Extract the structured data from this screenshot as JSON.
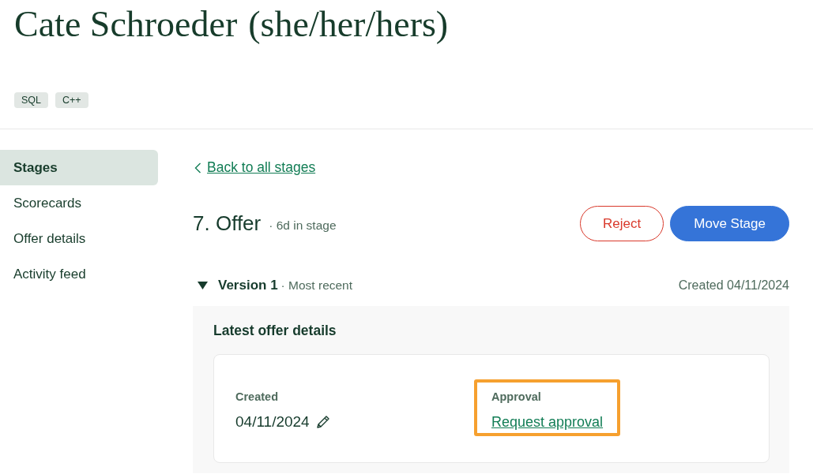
{
  "candidate": {
    "name": "Cate Schroeder",
    "pronouns": "(she/her/hers)",
    "tags": [
      "SQL",
      "C++"
    ]
  },
  "sidebar": {
    "items": [
      {
        "label": "Stages",
        "selected": true
      },
      {
        "label": "Scorecards",
        "selected": false
      },
      {
        "label": "Offer details",
        "selected": false
      },
      {
        "label": "Activity feed",
        "selected": false
      }
    ]
  },
  "stage": {
    "back_link": "Back to all stages",
    "title": "7. Offer",
    "time_in_stage": "· 6d in stage",
    "buttons": [
      {
        "label": "Reject",
        "kind": "danger"
      },
      {
        "label": "Move Stage",
        "kind": "primary"
      }
    ]
  },
  "version": {
    "title": "Version 1",
    "note": "· Most recent",
    "expanded": true,
    "created": "Created 04/11/2024",
    "panel_title": "Latest offer details",
    "fields": [
      {
        "label": "Created",
        "value": "04/11/2024",
        "kind": "editable",
        "highlighted": false
      },
      {
        "label": "Approval",
        "value": "Request approval",
        "kind": "link",
        "highlighted": true
      }
    ]
  }
}
